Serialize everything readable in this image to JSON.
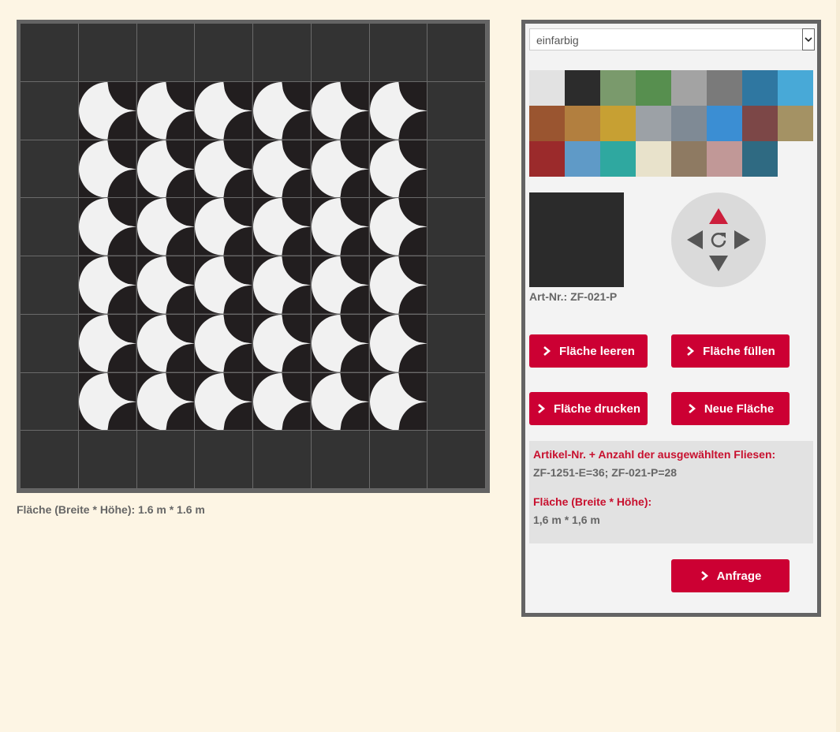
{
  "grid": {
    "cols": 8,
    "rows": 8,
    "border_color": "#333333",
    "pattern_tile": "ZF-1251-E",
    "border_tile": "ZF-021-P",
    "pattern_colors": {
      "dark": "#221e1f",
      "light": "#f1f1f1"
    }
  },
  "area_text": "Fläche (Breite * Höhe): 1.6 m * 1.6 m",
  "select": {
    "value": "einfarbig",
    "arrow_icon": "chevron-down-icon"
  },
  "swatches": [
    {
      "color": "#e2e2e2"
    },
    {
      "color": "#2c2c2c"
    },
    {
      "color": "#7a9a6c"
    },
    {
      "color": "#578f4f"
    },
    {
      "color": "#a3a3a3"
    },
    {
      "color": "#7a7a7a"
    },
    {
      "color": "#2f77a1"
    },
    {
      "color": "#48a9d7"
    },
    {
      "color": "#9a5530"
    },
    {
      "color": "#b27f3f"
    },
    {
      "color": "#c7a033"
    },
    {
      "color": "#9ca1a6"
    },
    {
      "color": "#7f8a95"
    },
    {
      "color": "#3b8ed3"
    },
    {
      "color": "#7c4747"
    },
    {
      "color": "#a49264"
    },
    {
      "color": "#9b2a2b"
    },
    {
      "color": "#5f9ac7"
    },
    {
      "color": "#2fa8a0"
    },
    {
      "color": "#e8e2cb"
    },
    {
      "color": "#8e7a62"
    },
    {
      "color": "#c19897"
    },
    {
      "color": "#2f6a82"
    }
  ],
  "preview": {
    "color": "#2b2b2b",
    "art_nr": "Art-Nr.: ZF-021-P"
  },
  "dpad": {
    "up_color": "#cc1f3c",
    "other_color": "#555555"
  },
  "buttons": {
    "clear": "Fläche leeren",
    "fill": "Fläche füllen",
    "print": "Fläche drucken",
    "new": "Neue Fläche",
    "request": "Anfrage"
  },
  "info": {
    "articles_label": "Artikel-Nr. + Anzahl der ausgewählten Fliesen:",
    "articles_value": "ZF-1251-E=36; ZF-021-P=28",
    "area_label": "Fläche (Breite * Höhe):",
    "area_value": "1,6 m * 1,6 m"
  },
  "colors": {
    "accent": "#cc0033",
    "panel_border": "#646464",
    "page_bg": "#fdf5e4"
  }
}
